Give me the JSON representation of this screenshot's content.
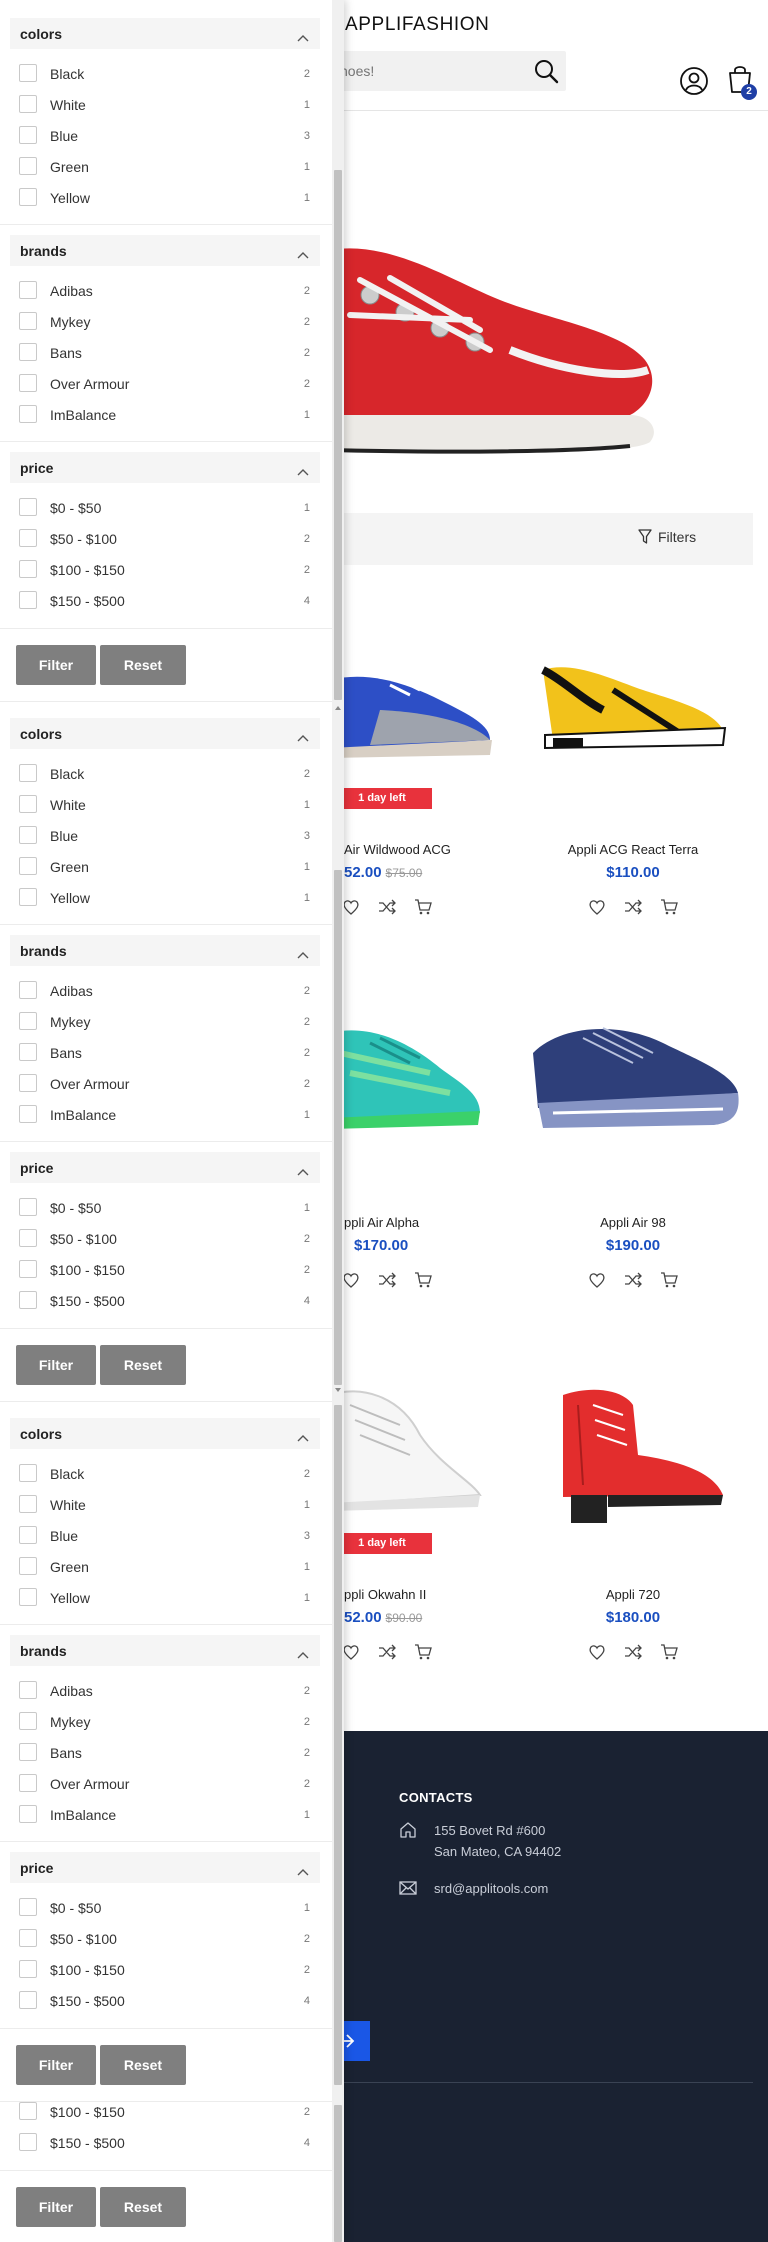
{
  "store": {
    "brand": "APPLIFASHION",
    "search_placeholder": "hoes!",
    "cart_count": "2",
    "filters_label": "Filters"
  },
  "products": [
    {
      "name": "Air Wildwood ACG",
      "price": "52.00",
      "old_price": "$75.00",
      "tag": "1 day left"
    },
    {
      "name": "Appli ACG React Terra",
      "price": "$110.00",
      "old_price": "",
      "tag": ""
    },
    {
      "name": "ppli Air Alpha",
      "price": "$170.00",
      "old_price": "",
      "tag": ""
    },
    {
      "name": "Appli Air 98",
      "price": "$190.00",
      "old_price": "",
      "tag": ""
    },
    {
      "name": "ppli Okwahn II",
      "price": "52.00",
      "old_price": "$90.00",
      "tag": "1 day left"
    },
    {
      "name": "Appli 720",
      "price": "$180.00",
      "old_price": "",
      "tag": ""
    }
  ],
  "footer": {
    "contacts_title": "CONTACTS",
    "address_line1": "155 Bovet Rd #600",
    "address_line2": "San Mateo, CA 94402",
    "email": "srd@applitools.com",
    "fragment": "s"
  },
  "filter_groups": {
    "colors": {
      "title": "colors",
      "items": [
        {
          "label": "Black",
          "count": "2"
        },
        {
          "label": "White",
          "count": "1"
        },
        {
          "label": "Blue",
          "count": "3"
        },
        {
          "label": "Green",
          "count": "1"
        },
        {
          "label": "Yellow",
          "count": "1"
        }
      ]
    },
    "brands": {
      "title": "brands",
      "items": [
        {
          "label": "Adibas",
          "count": "2"
        },
        {
          "label": "Mykey",
          "count": "2"
        },
        {
          "label": "Bans",
          "count": "2"
        },
        {
          "label": "Over Armour",
          "count": "2"
        },
        {
          "label": "ImBalance",
          "count": "1"
        }
      ]
    },
    "price": {
      "title": "price",
      "items": [
        {
          "label": "$0 - $50",
          "count": "1"
        },
        {
          "label": "$50 - $100",
          "count": "2"
        },
        {
          "label": "$100 - $150",
          "count": "2"
        },
        {
          "label": "$150 - $500",
          "count": "4"
        }
      ]
    },
    "price_partial": {
      "title": "",
      "items": [
        {
          "label": "$100 - $150",
          "count": "2"
        },
        {
          "label": "$150 - $500",
          "count": "4"
        }
      ]
    }
  },
  "buttons": {
    "filter": "Filter",
    "reset": "Reset"
  },
  "colors": {
    "accent_blue": "#1a4fc0",
    "sale_red": "#e8323c",
    "footer_bg": "#1a2232",
    "button_gray": "#7f7f7f"
  }
}
